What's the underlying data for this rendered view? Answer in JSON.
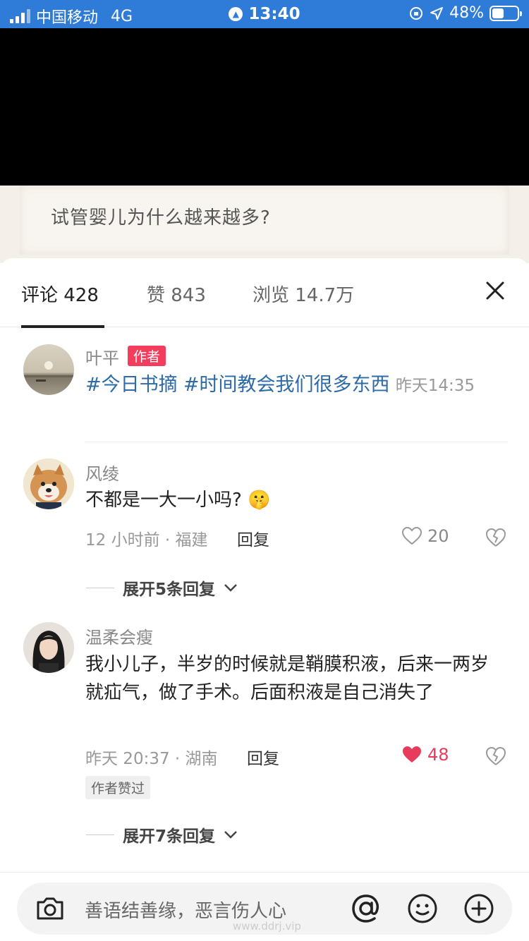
{
  "status_bar": {
    "carrier": "中国移动",
    "network": "4G",
    "time": "13:40",
    "battery": "48%",
    "battery_level": 0.48
  },
  "question": {
    "text": "试管婴儿为什么越来越多?"
  },
  "tabs": [
    {
      "label": "评论 428"
    },
    {
      "label": "赞 843"
    },
    {
      "label": "浏览 14.7万"
    }
  ],
  "comments": [
    {
      "name": "叶平",
      "tag": "作者",
      "hashtag_1": "#今日书摘",
      "hashtag_2": "#时间教会我们很多东西",
      "time": "昨天14:35"
    },
    {
      "name": "风绫",
      "text": "不都是一大一小吗?",
      "emoji": "🤫",
      "meta": "12 小时前 · 福建",
      "reply": "回复",
      "likes": "20",
      "liked": false,
      "expand": "展开5条回复"
    },
    {
      "name": "温柔会瘦",
      "text": "我小儿子，半岁的时候就是鞘膜积液，后来一两岁就疝气，做了手术。后面积液是自己消失了",
      "meta": "昨天 20:37 · 湖南",
      "reply": "回复",
      "likes": "48",
      "liked": true,
      "badge": "作者赞过",
      "expand": "展开7条回复"
    }
  ],
  "input_bar": {
    "placeholder": "善语结善缘，恶言伤人心",
    "watermark": "www.ddrj.vip"
  },
  "icons": {
    "camera": "camera-icon",
    "at": "at-icon",
    "emoji": "emoji-icon",
    "plus": "plus-icon",
    "close": "close-icon"
  },
  "colors": {
    "status_bar": "#2f7bd8",
    "author_tag": "#f23d5c",
    "hashtag": "#2c6aa8",
    "liked_heart": "#e63b5b"
  }
}
